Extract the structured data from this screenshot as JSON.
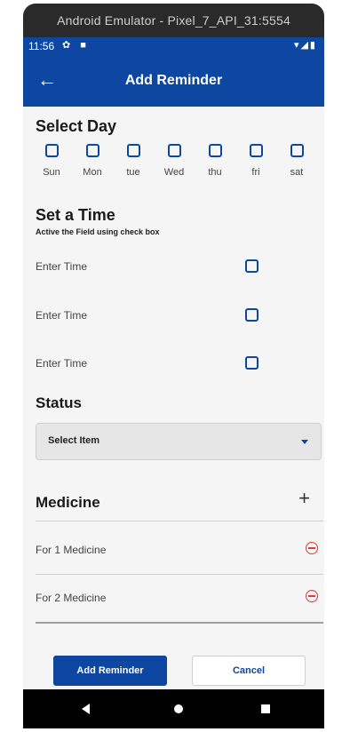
{
  "window": {
    "title": "Android Emulator - Pixel_7_API_31:5554"
  },
  "status_bar": {
    "time": "11:56",
    "left_icons": "✿ ■",
    "right_icons": "▾◢▮"
  },
  "app_bar": {
    "back_glyph": "←",
    "title": "Add Reminder"
  },
  "select_day": {
    "heading": "Select Day",
    "days": [
      "Sun",
      "Mon",
      "tue",
      "Wed",
      "thu",
      "fri",
      "sat"
    ]
  },
  "set_time": {
    "heading": "Set a Time",
    "hint": "Active the Field using check box",
    "fields": [
      "Enter Time",
      "Enter Time",
      "Enter Time"
    ]
  },
  "status": {
    "heading": "Status",
    "select_value": "Select Item"
  },
  "medicine": {
    "heading": "Medicine",
    "add_glyph": "+",
    "items": [
      "For 1 Medicine",
      "For 2 Medicine"
    ]
  },
  "actions": {
    "primary_label": "Add Reminder",
    "secondary_label": "Cancel"
  },
  "colors": {
    "primary": "#0d47a1",
    "danger": "#e53935",
    "background": "#f5f5f5"
  }
}
